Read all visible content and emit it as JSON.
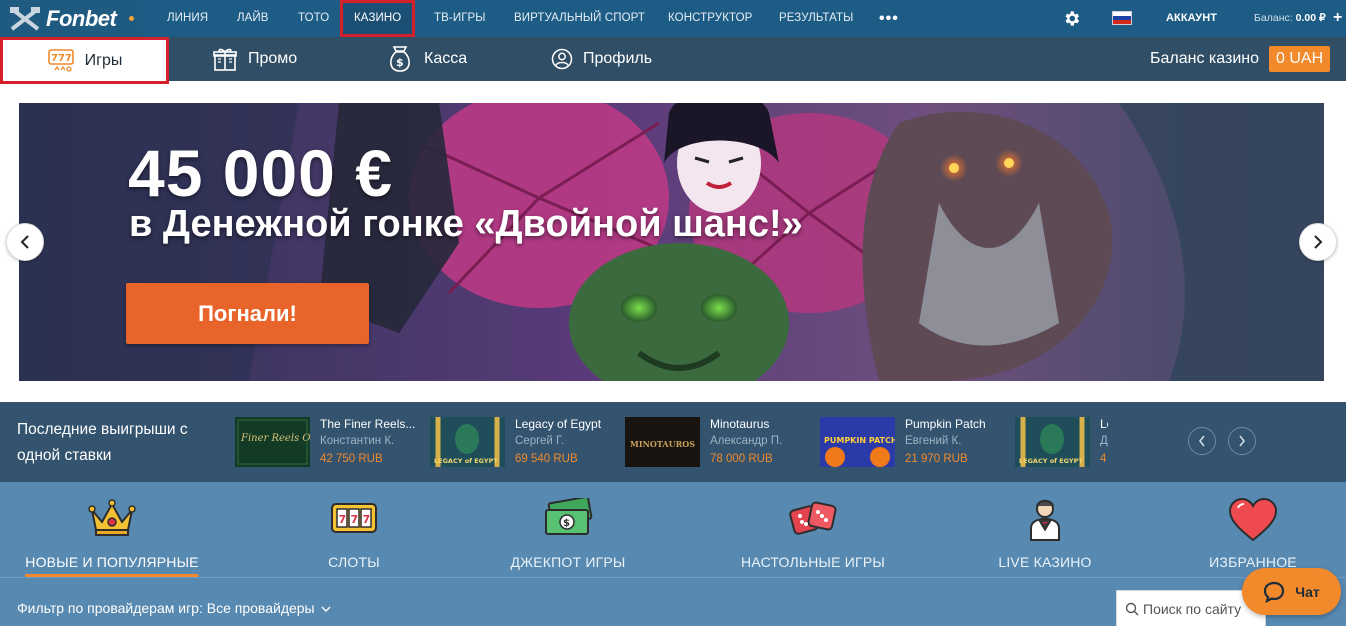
{
  "brand": {
    "name": "Fonbet"
  },
  "topnav": {
    "items": [
      "ЛИНИЯ",
      "ЛАЙВ",
      "ТОТО",
      "КАЗИНО",
      "ТВ-ИГРЫ",
      "ВИРТУАЛЬНЫЙ СПОРТ",
      "КОНСТРУКТОР",
      "РЕЗУЛЬТАТЫ"
    ],
    "more": "•••",
    "account": "АККАУНТ",
    "balance_label": "Баланс:",
    "balance_value": "0.00 ₽",
    "plus": "+"
  },
  "subnav": {
    "items": [
      "Игры",
      "Промо",
      "Касса",
      "Профиль"
    ],
    "casino_balance_label": "Баланс казино",
    "casino_balance_value": "0 UAH"
  },
  "banner": {
    "amount": "45 000 €",
    "subtitle": "в Денежной гонке «Двойной шанс!»",
    "cta": "Погнали!"
  },
  "wins": {
    "title": "Последние выигрыши с одной ставки",
    "items": [
      {
        "game": "The Finer Reels...",
        "user": "Константин К.",
        "amount": "42 750 RUB"
      },
      {
        "game": "Legacy of Egypt",
        "user": "Сергей Г.",
        "amount": "69 540 RUB"
      },
      {
        "game": "Minotaurus",
        "user": "Александр П.",
        "amount": "78 000 RUB"
      },
      {
        "game": "Pumpkin Patch",
        "user": "Евгений К.",
        "amount": "21 970 RUB"
      },
      {
        "game": "Le",
        "user": "Д",
        "amount": "4"
      }
    ],
    "thumbs": [
      "Finer Reels OF LIFE",
      "LEGACY of EGYPT",
      "MINOTAUROS",
      "PUMPKIN PATCH",
      "LEGACY of EGYPT"
    ]
  },
  "categories": [
    {
      "label": "НОВЫЕ И ПОПУЛЯРНЫЕ",
      "icon": "crown-icon"
    },
    {
      "label": "СЛОТЫ",
      "icon": "slot-777-icon"
    },
    {
      "label": "ДЖЕКПОТ ИГРЫ",
      "icon": "money-stack-icon"
    },
    {
      "label": "НАСТОЛЬНЫЕ ИГРЫ",
      "icon": "dice-icon"
    },
    {
      "label": "LIVE КАЗИНО",
      "icon": "dealer-icon"
    },
    {
      "label": "ИЗБРАННОЕ",
      "icon": "heart-icon"
    }
  ],
  "filter": {
    "label": "Фильтр по провайдерам игр:",
    "value": "Все провайдеры"
  },
  "search": {
    "placeholder": "Поиск по сайту"
  },
  "chat": {
    "label": "Чат"
  },
  "colors": {
    "topnav": "#1d5c85",
    "subnav": "#304e66",
    "wins": "#33536e",
    "categories": "#5789b1",
    "accent_orange": "#f28a2b",
    "highlight_red": "#d3202a"
  }
}
